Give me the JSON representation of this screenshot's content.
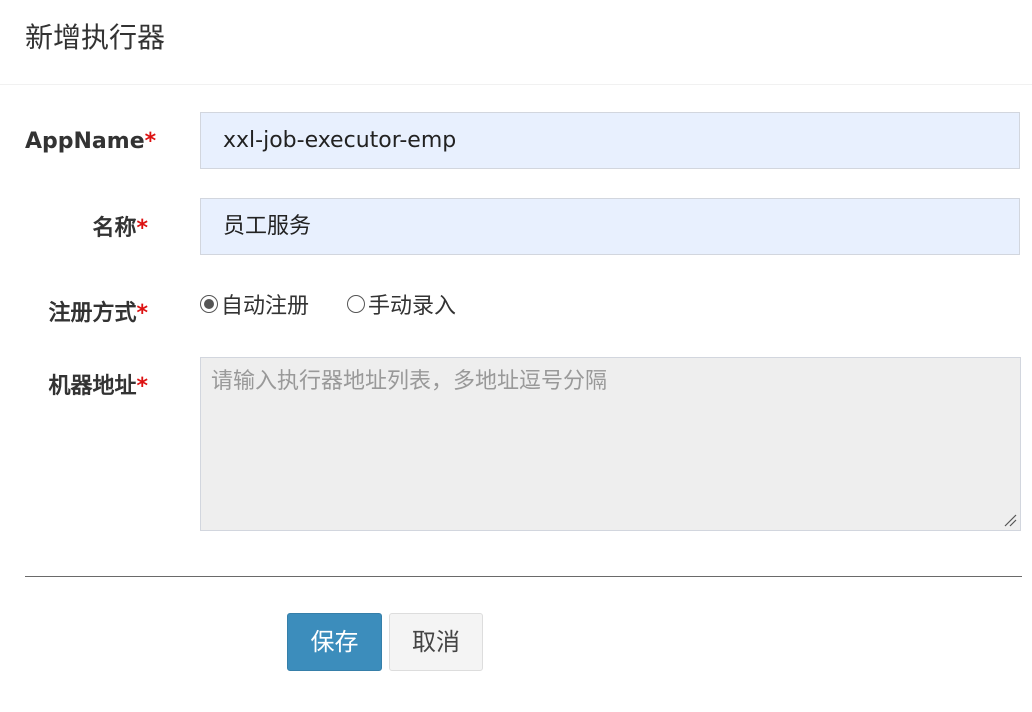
{
  "modal": {
    "title": "新增执行器"
  },
  "form": {
    "app_name": {
      "label": "AppName",
      "required_mark": "*",
      "value": "xxl-job-executor-emp"
    },
    "title": {
      "label": "名称",
      "required_mark": "*",
      "value": "员工服务"
    },
    "address_type": {
      "label": "注册方式",
      "required_mark": "*",
      "options": [
        {
          "label": "自动注册",
          "checked": true
        },
        {
          "label": "手动录入",
          "checked": false
        }
      ]
    },
    "address_list": {
      "label": "机器地址",
      "required_mark": "*",
      "placeholder": "请输入执行器地址列表，多地址逗号分隔",
      "disabled": true
    }
  },
  "footer": {
    "save_label": "保存",
    "cancel_label": "取消"
  },
  "colors": {
    "primary": "#3c8dbc",
    "required": "#dd1111",
    "autofill_bg": "#e8f0fe",
    "disabled_bg": "#eeeeee"
  }
}
